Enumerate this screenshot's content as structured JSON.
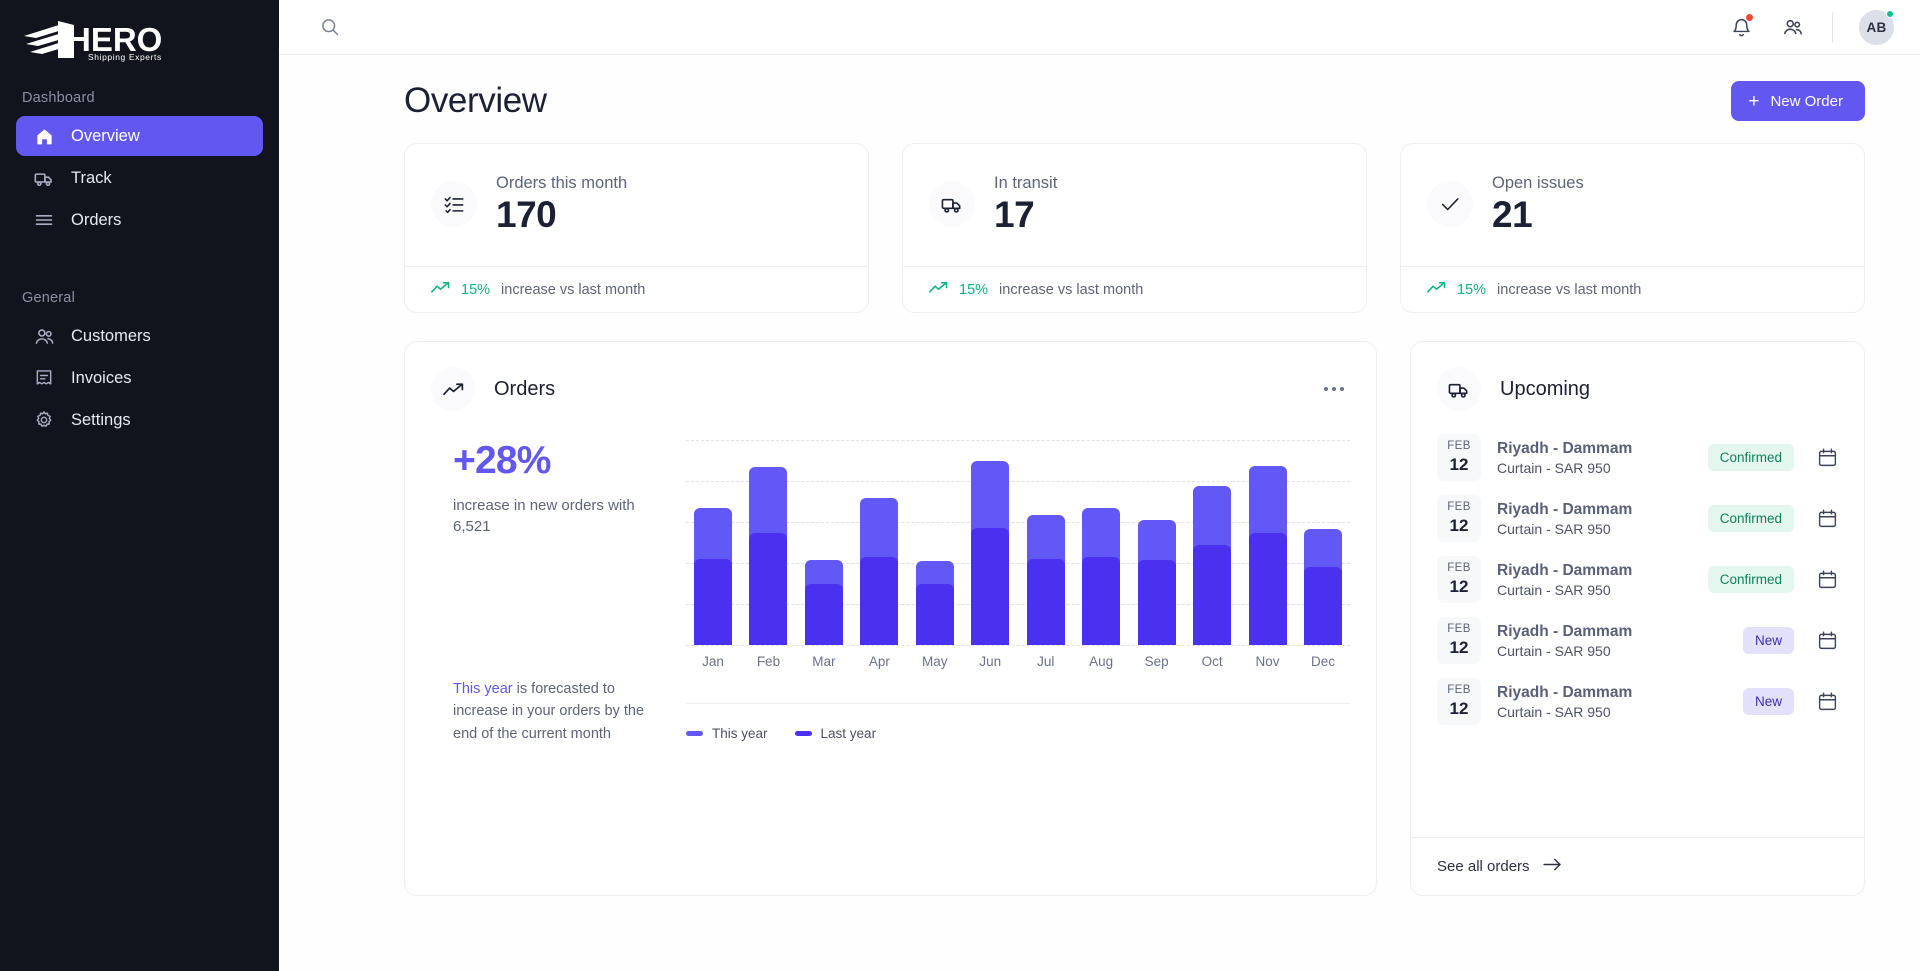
{
  "brand": {
    "name": "HERO",
    "tagline": "Shipping Experts"
  },
  "sidebar": {
    "sections": [
      {
        "label": "Dashboard",
        "items": [
          {
            "label": "Overview",
            "icon": "home-icon",
            "active": true
          },
          {
            "label": "Track",
            "icon": "truck-icon",
            "active": false
          },
          {
            "label": "Orders",
            "icon": "list-icon",
            "active": false
          }
        ]
      },
      {
        "label": "General",
        "items": [
          {
            "label": "Customers",
            "icon": "users-icon",
            "active": false
          },
          {
            "label": "Invoices",
            "icon": "invoice-icon",
            "active": false
          },
          {
            "label": "Settings",
            "icon": "gear-icon",
            "active": false
          }
        ]
      }
    ]
  },
  "topbar": {
    "search_icon": "search-icon",
    "notifications_icon": "bell-icon",
    "contacts_icon": "people-icon",
    "avatar_initials": "AB",
    "has_notification": true,
    "status_online": true
  },
  "header": {
    "title": "Overview",
    "new_order_label": "New Order",
    "new_order_icon": "plus-icon"
  },
  "stats": [
    {
      "label": "Orders this month",
      "value": "170",
      "icon": "checklist-icon",
      "trend_pct": "15%",
      "trend_text": "increase vs last month"
    },
    {
      "label": "In transit",
      "value": "17",
      "icon": "truck-icon",
      "trend_pct": "15%",
      "trend_text": "increase vs last month"
    },
    {
      "label": "Open issues",
      "value": "21",
      "icon": "check-icon",
      "trend_pct": "15%",
      "trend_text": "increase vs last month"
    }
  ],
  "orders_panel": {
    "title": "Orders",
    "icon": "trending-up-icon",
    "menu_icon": "more-horizontal-icon",
    "big_pct": "+28%",
    "sub_text": "increase in new orders with 6,521",
    "forecast_highlight": "This year",
    "forecast_rest": " is forecasted to increase in your orders by the end of the current month"
  },
  "chart_data": {
    "type": "bar",
    "stacked": true,
    "title": "Orders",
    "xlabel": "",
    "ylabel": "",
    "grid": true,
    "gridlines": 6,
    "legend_position": "bottom-left",
    "categories": [
      "Jan",
      "Feb",
      "Mar",
      "Apr",
      "May",
      "Jun",
      "Jul",
      "Aug",
      "Sep",
      "Oct",
      "Nov",
      "Dec"
    ],
    "series": [
      {
        "name": "Last year",
        "color": "#4A31EF",
        "values": [
          47,
          62,
          32,
          48,
          32,
          65,
          47,
          48,
          46,
          55,
          62,
          42
        ]
      },
      {
        "name": "This year",
        "color": "#6158F5",
        "values": [
          33,
          42,
          18,
          38,
          17,
          43,
          29,
          32,
          27,
          38,
          43,
          26
        ]
      }
    ],
    "totals": [
      80,
      104,
      50,
      86,
      49,
      108,
      76,
      80,
      73,
      93,
      105,
      68
    ],
    "ylim": [
      0,
      120
    ]
  },
  "upcoming": {
    "title": "Upcoming",
    "icon": "truck-icon",
    "calendar_icon": "calendar-icon",
    "see_all_label": "See all orders",
    "see_all_icon": "arrow-right-icon",
    "rows": [
      {
        "month": "FEB",
        "day": "12",
        "route": "Riyadh - Dammam",
        "meta": "Curtain - SAR 950",
        "status": "Confirmed",
        "status_kind": "confirmed"
      },
      {
        "month": "FEB",
        "day": "12",
        "route": "Riyadh - Dammam",
        "meta": "Curtain - SAR 950",
        "status": "Confirmed",
        "status_kind": "confirmed"
      },
      {
        "month": "FEB",
        "day": "12",
        "route": "Riyadh - Dammam",
        "meta": "Curtain - SAR 950",
        "status": "Confirmed",
        "status_kind": "confirmed"
      },
      {
        "month": "FEB",
        "day": "12",
        "route": "Riyadh - Dammam",
        "meta": "Curtain - SAR 950",
        "status": "New",
        "status_kind": "new"
      },
      {
        "month": "FEB",
        "day": "12",
        "route": "Riyadh - Dammam",
        "meta": "Curtain - SAR 950",
        "status": "New",
        "status_kind": "new"
      }
    ]
  },
  "colors": {
    "primary": "#6257F0",
    "bar_dark": "#4A31EF",
    "bar_light": "#6158F5",
    "success": "#10B183",
    "sidebar_bg": "#12141D",
    "badge_confirmed_bg": "#E4F7EF",
    "badge_confirmed_fg": "#13805D",
    "badge_new_bg": "#E2E0FB",
    "badge_new_fg": "#3B2FB0"
  }
}
